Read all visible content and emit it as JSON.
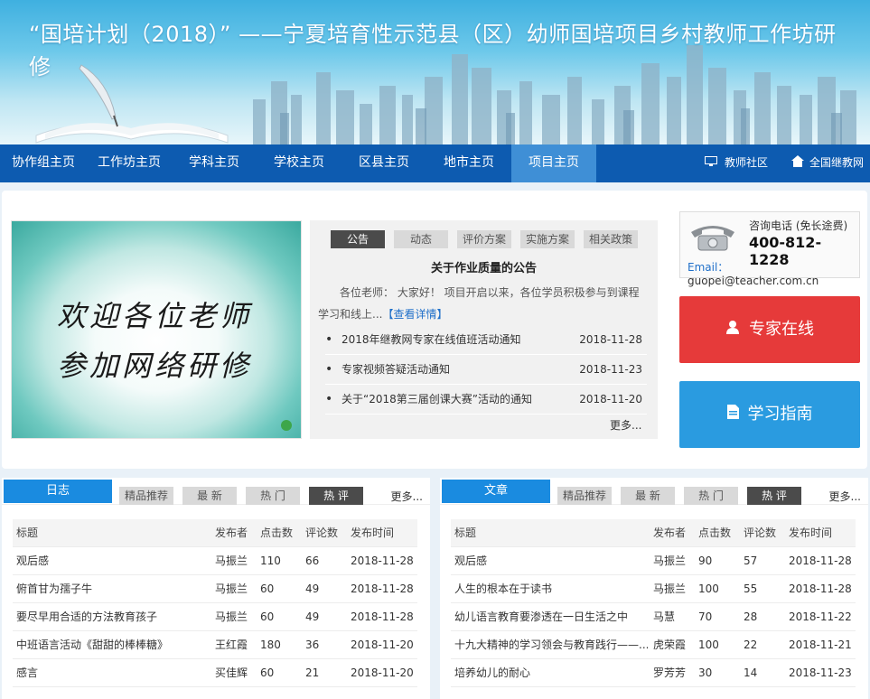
{
  "banner": {
    "title": "“国培计划（2018）” ——宁夏培育性示范县（区）幼师国培项目乡村教师工作坊研修"
  },
  "nav": {
    "items": [
      "协作组主页",
      "工作坊主页",
      "学科主页",
      "学校主页",
      "区县主页",
      "地市主页",
      "项目主页"
    ],
    "active_index": 6,
    "right": {
      "community": "教师社区",
      "network": "全国继教网"
    }
  },
  "slider": {
    "line1": "欢迎各位老师",
    "line2": "参加网络研修"
  },
  "notice": {
    "tabs": [
      "公告",
      "动态",
      "评价方案",
      "实施方案",
      "相关政策"
    ],
    "active_tab": 0,
    "title": "关于作业质量的公告",
    "body": "各位老师： 大家好！ 项目开启以来，各位学员积极参与到课程学习和线上...",
    "details_link": "【查看详情】",
    "items": [
      {
        "text": "2018年继教网专家在线值班活动通知",
        "date": "2018-11-28"
      },
      {
        "text": "专家视频答疑活动通知",
        "date": "2018-11-23"
      },
      {
        "text": "关于“2018第三届创课大赛”活动的通知",
        "date": "2018-11-20"
      }
    ],
    "more": "更多..."
  },
  "contact": {
    "label": "咨询电话 (免长途费)",
    "tel": "400-812-1228",
    "email_key": "Email：",
    "email": "guopei@teacher.com.cn"
  },
  "buttons": {
    "expert": {
      "label": "专家在线",
      "color": "#e63a3a"
    },
    "guide": {
      "label": "学习指南",
      "color": "#2a9be0"
    }
  },
  "blog": {
    "title": "日志",
    "tabs": [
      "精品推荐",
      "最 新",
      "热 门",
      "热 评"
    ],
    "active_tab": 3,
    "more": "更多...",
    "headers": [
      "标题",
      "发布者",
      "点击数",
      "评论数",
      "发布时间"
    ],
    "rows": [
      [
        "观后感",
        "马振兰",
        "110",
        "66",
        "2018-11-28"
      ],
      [
        "俯首甘为孺子牛",
        "马振兰",
        "60",
        "49",
        "2018-11-28"
      ],
      [
        "要尽早用合适的方法教育孩子",
        "马振兰",
        "60",
        "49",
        "2018-11-28"
      ],
      [
        "中班语言活动《甜甜的棒棒糖》",
        "王红霞",
        "180",
        "36",
        "2018-11-20"
      ],
      [
        "感言",
        "买佳辉",
        "60",
        "21",
        "2018-11-20"
      ]
    ]
  },
  "article": {
    "title": "文章",
    "tabs": [
      "精品推荐",
      "最 新",
      "热 门",
      "热 评"
    ],
    "active_tab": 3,
    "more": "更多...",
    "headers": [
      "标题",
      "发布者",
      "点击数",
      "评论数",
      "发布时间"
    ],
    "rows": [
      [
        "观后感",
        "马振兰",
        "90",
        "57",
        "2018-11-28"
      ],
      [
        "人生的根本在于读书",
        "马振兰",
        "100",
        "55",
        "2018-11-28"
      ],
      [
        "幼儿语言教育要渗透在一日生活之中",
        "马慧",
        "70",
        "28",
        "2018-11-22"
      ],
      [
        "十九大精神的学习领会与教育践行——...",
        "虎荣霞",
        "100",
        "22",
        "2018-11-21"
      ],
      [
        "培养幼儿的耐心",
        "罗芳芳",
        "30",
        "14",
        "2018-11-23"
      ]
    ]
  }
}
